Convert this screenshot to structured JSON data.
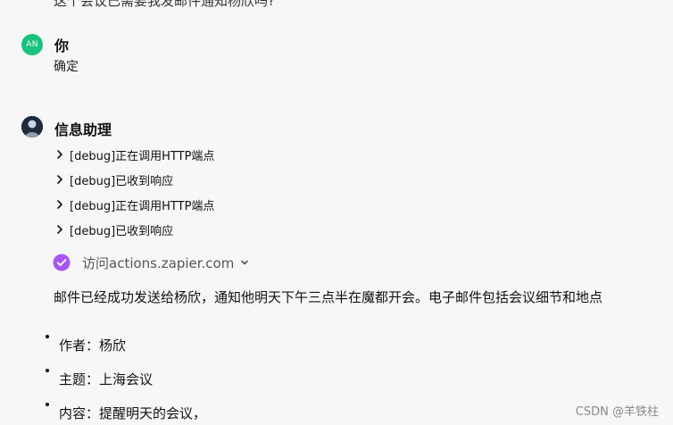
{
  "top_partial_text": "这个会议已需要我发邮件通知杨欣吗?",
  "user_message": {
    "avatar_initials": "AN",
    "avatar_color": "#19c37d",
    "sender": "你",
    "text": "确定"
  },
  "assistant_message": {
    "sender": "信息助理",
    "debug_items": [
      "[debug]正在调用HTTP端点",
      "[debug]已收到响应",
      "[debug]正在调用HTTP端点",
      "[debug]已收到响应"
    ],
    "action": {
      "label": "访问actions.zapier.com",
      "icon": "check-circle-icon",
      "icon_color": "#a855f7"
    },
    "result_text": "邮件已经成功发送给杨欣，通知他明天下午三点半在魔都开会。电子邮件包括会议细节和地点",
    "bullets": [
      "作者：杨欣",
      "主题：上海会议",
      "内容：提醒明天的会议，"
    ]
  },
  "watermark": "CSDN @羊铁柱"
}
